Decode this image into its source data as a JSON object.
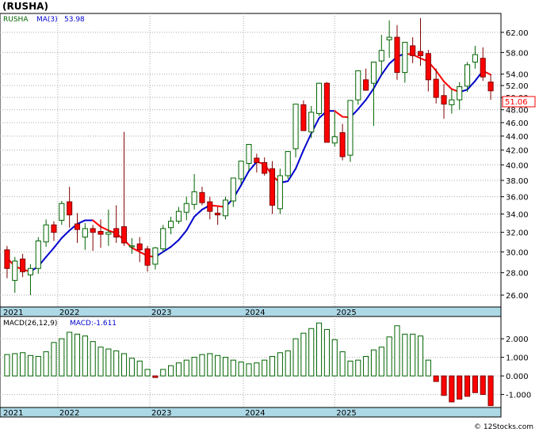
{
  "header": {
    "title": "(RUSHA)",
    "symbol_legend": "RUSHA",
    "ma_legend": "MA(3)",
    "ma_value": "53.98",
    "last_price": "51.06"
  },
  "macd": {
    "label": "MACD(26,12,9)",
    "value_label": "MACD:-1.611"
  },
  "footer": {
    "credit": "© 12Stocks.com"
  },
  "colors": {
    "up": "#006400",
    "down": "#ff0000",
    "ma_up": "#0000cc",
    "ma_down": "#ff0000",
    "axis_band": "#add8e6",
    "grid": "#aaaaaa"
  },
  "chart_data": [
    {
      "type": "candlestick",
      "title": "(RUSHA)",
      "scale": "log",
      "ylim": [
        25,
        66
      ],
      "yticks": [
        "62.00",
        "58.00",
        "54.00",
        "52.00",
        "50.00",
        "48.00",
        "46.00",
        "44.00",
        "42.00",
        "40.00",
        "38.00",
        "36.00",
        "34.00",
        "32.00",
        "30.00",
        "28.00",
        "26.00"
      ],
      "x_years": [
        "2021",
        "2022",
        "2023",
        "2024",
        "2025"
      ],
      "series": [
        {
          "name": "RUSHA",
          "ohlc": [
            [
              30.2,
              30.6,
              27.5,
              28.4
            ],
            [
              27.3,
              29.5,
              26.2,
              29.1
            ],
            [
              29.3,
              29.8,
              27.6,
              28.1
            ],
            [
              27.8,
              28.8,
              26.0,
              28.4
            ],
            [
              28.4,
              31.5,
              27.9,
              31.1
            ],
            [
              31.0,
              33.4,
              30.5,
              32.8
            ],
            [
              32.8,
              33.2,
              31.1,
              32.0
            ],
            [
              33.3,
              35.5,
              32.8,
              35.2
            ],
            [
              35.4,
              37.2,
              32.5,
              33.9
            ],
            [
              32.9,
              34.1,
              30.9,
              32.3
            ],
            [
              31.5,
              33.0,
              30.2,
              32.4
            ],
            [
              32.4,
              32.8,
              30.1,
              32.0
            ],
            [
              32.1,
              33.4,
              30.4,
              31.8
            ],
            [
              31.8,
              34.5,
              30.6,
              32.0
            ],
            [
              32.4,
              35.0,
              30.9,
              31.5
            ],
            [
              32.6,
              44.6,
              30.6,
              30.9
            ],
            [
              30.5,
              31.4,
              29.8,
              30.6
            ],
            [
              30.8,
              31.5,
              29.0,
              30.2
            ],
            [
              30.3,
              30.6,
              28.1,
              28.7
            ],
            [
              28.8,
              30.5,
              28.3,
              30.4
            ],
            [
              30.3,
              32.8,
              30.0,
              32.4
            ],
            [
              32.5,
              33.7,
              31.8,
              33.2
            ],
            [
              33.2,
              34.8,
              32.9,
              34.3
            ],
            [
              34.2,
              36.0,
              33.3,
              35.2
            ],
            [
              35.1,
              38.8,
              34.5,
              36.6
            ],
            [
              36.5,
              37.2,
              35.0,
              35.3
            ],
            [
              35.4,
              36.0,
              33.4,
              34.3
            ],
            [
              34.1,
              34.8,
              32.8,
              33.9
            ],
            [
              33.8,
              36.0,
              33.4,
              35.6
            ],
            [
              35.5,
              38.0,
              34.8,
              38.3
            ],
            [
              38.2,
              40.5,
              37.5,
              40.5
            ],
            [
              40.2,
              41.4,
              39.2,
              42.8
            ],
            [
              40.9,
              41.5,
              39.0,
              40.3
            ],
            [
              40.3,
              41.0,
              38.6,
              38.9
            ],
            [
              39.5,
              40.5,
              34.0,
              35.0
            ],
            [
              34.6,
              39.5,
              34.0,
              38.6
            ],
            [
              38.6,
              41.5,
              38.2,
              41.8
            ],
            [
              42.2,
              44.0,
              41.0,
              48.9
            ],
            [
              48.8,
              49.5,
              44.8,
              44.8
            ],
            [
              44.6,
              48.6,
              43.7,
              47.6
            ],
            [
              47.4,
              52.5,
              47.0,
              52.4
            ],
            [
              52.4,
              52.6,
              43.2,
              43.1
            ],
            [
              43.0,
              47.6,
              42.5,
              43.9
            ],
            [
              44.5,
              45.8,
              40.6,
              41.1
            ],
            [
              41.3,
              45.6,
              40.4,
              49.5
            ],
            [
              49.6,
              54.6,
              48.8,
              54.6
            ],
            [
              53.0,
              55.0,
              51.2,
              51.2
            ],
            [
              52.4,
              55.0,
              45.5,
              56.2
            ],
            [
              56.4,
              61.5,
              53.8,
              58.4
            ],
            [
              60.5,
              64.5,
              57.0,
              61.0
            ],
            [
              61.0,
              63.5,
              53.0,
              54.3
            ],
            [
              54.3,
              59.8,
              52.5,
              60.0
            ],
            [
              59.3,
              61.0,
              56.0,
              57.4
            ],
            [
              58.2,
              65.0,
              55.5,
              57.4
            ],
            [
              57.8,
              58.5,
              51.0,
              53.0
            ],
            [
              53.1,
              55.0,
              49.0,
              50.0
            ],
            [
              50.3,
              52.3,
              46.6,
              48.9
            ],
            [
              48.8,
              51.3,
              47.4,
              49.6
            ],
            [
              49.6,
              52.6,
              48.0,
              51.8
            ],
            [
              51.9,
              56.2,
              50.9,
              55.7
            ],
            [
              56.2,
              59.3,
              55.0,
              57.6
            ],
            [
              56.9,
              59.0,
              52.8,
              53.5
            ],
            [
              52.6,
              54.0,
              49.6,
              51.1
            ]
          ]
        },
        {
          "name": "MA(3)",
          "values": [
            29.4,
            28.6,
            28.3,
            28.1,
            28.6,
            29.5,
            30.4,
            31.4,
            32.2,
            32.9,
            33.3,
            33.3,
            32.6,
            32.2,
            31.9,
            31.2,
            30.4,
            30.0,
            29.6,
            29.5,
            30.0,
            30.5,
            31.2,
            32.2,
            33.7,
            34.5,
            35.0,
            34.9,
            34.8,
            35.8,
            37.4,
            39.2,
            40.4,
            40.1,
            38.6,
            37.7,
            37.9,
            39.5,
            42.0,
            44.4,
            46.7,
            47.8,
            47.8,
            46.9,
            46.8,
            48.1,
            49.6,
            51.5,
            53.9,
            55.9,
            57.2,
            57.8,
            57.6,
            56.9,
            56.3,
            54.6,
            52.7,
            51.4,
            50.9,
            51.3,
            52.8,
            54.6,
            53.9
          ]
        }
      ]
    },
    {
      "type": "bar",
      "title": "MACD(26,12,9)",
      "ylim": [
        -1.7,
        3.2
      ],
      "yticks": [
        "2.000",
        "1.000",
        "0.000",
        "-1.000"
      ],
      "values": [
        1.15,
        1.2,
        1.25,
        1.1,
        1.05,
        1.3,
        1.8,
        2.0,
        2.35,
        2.25,
        2.15,
        1.85,
        1.55,
        1.45,
        1.35,
        1.2,
        0.95,
        0.8,
        0.35,
        -0.08,
        0.35,
        0.55,
        0.7,
        0.85,
        1.0,
        1.15,
        1.2,
        1.1,
        1.0,
        0.85,
        0.75,
        0.65,
        0.7,
        0.85,
        1.05,
        1.25,
        1.35,
        2.0,
        2.3,
        2.55,
        2.85,
        2.5,
        1.95,
        1.3,
        0.8,
        0.85,
        1.05,
        1.4,
        1.55,
        2.1,
        2.7,
        2.25,
        2.25,
        2.15,
        0.85,
        -0.3,
        -1.05,
        -1.4,
        -1.25,
        -1.1,
        -0.9,
        -1.0,
        -1.6
      ]
    }
  ]
}
